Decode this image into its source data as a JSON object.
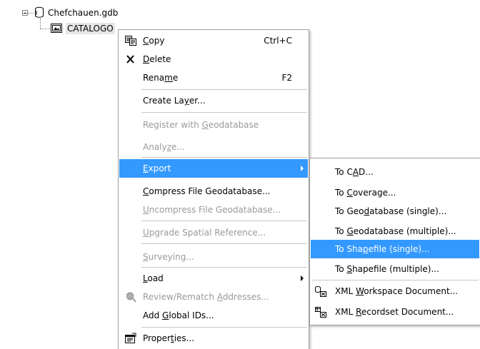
{
  "tree": {
    "root_label": "Chefchauen.gdb",
    "child_label": "CATALOGO"
  },
  "context_menu": {
    "items": [
      {
        "pre": "",
        "u": "C",
        "post": "opy",
        "accel": "Ctrl+C",
        "icon": "copy-icon"
      },
      {
        "pre": "",
        "u": "D",
        "post": "elete",
        "accel": "",
        "icon": "delete-x-icon"
      },
      {
        "pre": "Rena",
        "u": "m",
        "post": "e",
        "accel": "F2",
        "icon": ""
      },
      {
        "pre": "Create La",
        "u": "y",
        "post": "er...",
        "accel": "",
        "icon": ""
      },
      {
        "pre": "Register with ",
        "u": "G",
        "post": "eodatabase",
        "accel": "",
        "icon": ""
      },
      {
        "pre": "Analy",
        "u": "z",
        "post": "e...",
        "accel": "",
        "icon": ""
      },
      {
        "pre": "",
        "u": "E",
        "post": "xport",
        "accel": "",
        "icon": ""
      },
      {
        "pre": "",
        "u": "C",
        "post": "ompress File Geodatabase...",
        "accel": "",
        "icon": ""
      },
      {
        "pre": "",
        "u": "U",
        "post": "ncompress File Geodatabase...",
        "accel": "",
        "icon": ""
      },
      {
        "pre": "",
        "u": "U",
        "post": "pgrade Spatial Reference...",
        "accel": "",
        "icon": ""
      },
      {
        "pre": "",
        "u": "S",
        "post": "urveying...",
        "accel": "",
        "icon": ""
      },
      {
        "pre": "",
        "u": "L",
        "post": "oad",
        "accel": "",
        "icon": ""
      },
      {
        "pre": "Review/Rematch ",
        "u": "A",
        "post": "ddresses...",
        "accel": "",
        "icon": "review-rematch-icon"
      },
      {
        "pre": "Add ",
        "u": "G",
        "post": "lobal IDs...",
        "accel": "",
        "icon": ""
      },
      {
        "pre": "Proper",
        "u": "t",
        "post": "ies...",
        "accel": "",
        "icon": "properties-icon"
      }
    ]
  },
  "export_submenu": {
    "items": [
      {
        "pre": "To C",
        "u": "A",
        "post": "D..."
      },
      {
        "pre": "To ",
        "u": "C",
        "post": "overage..."
      },
      {
        "pre": "To Geo",
        "u": "d",
        "post": "atabase (single)..."
      },
      {
        "pre": "To ",
        "u": "G",
        "post": "eodatabase (multiple)..."
      },
      {
        "pre": "To Sha",
        "u": "p",
        "post": "efile (single)..."
      },
      {
        "pre": "To ",
        "u": "S",
        "post": "hapefile (multiple)..."
      },
      {
        "pre": "XML ",
        "u": "W",
        "post": "orkspace Document..."
      },
      {
        "pre": "XML ",
        "u": "R",
        "post": "ecordset Document..."
      }
    ]
  },
  "colors": {
    "highlight": "#3399ff",
    "disabled_text": "#9a9a9a",
    "menu_border": "#a0a0a0"
  }
}
